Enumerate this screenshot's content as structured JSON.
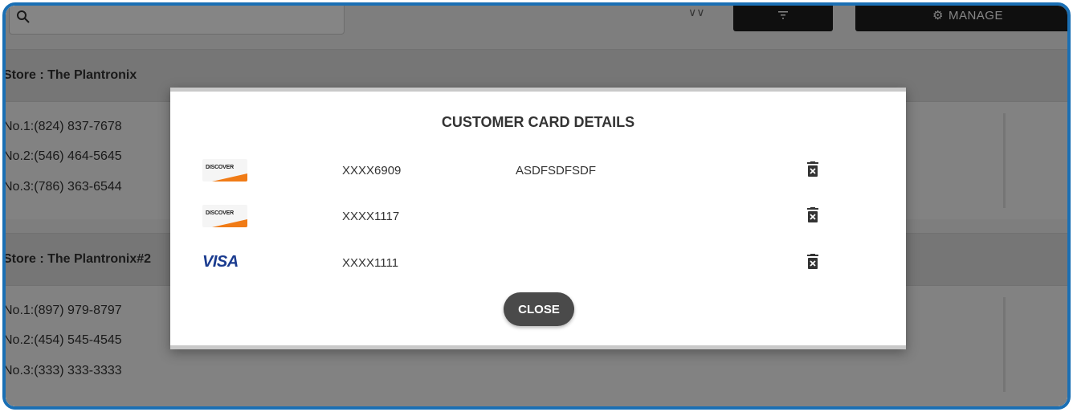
{
  "toolbar": {
    "manage_label": "MANAGE"
  },
  "stores": [
    {
      "header": "Store : The Plantronix",
      "phones": [
        "No.1:(824) 837-7678",
        "No.2:(546) 464-5645",
        "No.3:(786) 363-6544"
      ]
    },
    {
      "header": "Store : The Plantronix#2",
      "phones": [
        "No.1:(897) 979-8797",
        "No.2:(454) 545-4545",
        "No.3:(333) 333-3333"
      ]
    }
  ],
  "modal": {
    "title": "CUSTOMER CARD DETAILS",
    "cards": [
      {
        "brand": "DISCOVER",
        "logo_text": "DISCOVER",
        "number": "XXXX6909",
        "name": "ASDFSDFSDF"
      },
      {
        "brand": "DISCOVER",
        "logo_text": "DISCOVER",
        "number": "XXXX1117",
        "name": ""
      },
      {
        "brand": "VISA",
        "logo_text": "VISA",
        "number": "XXXX1111",
        "name": ""
      }
    ],
    "close_label": "CLOSE"
  },
  "colors": {
    "frame_border": "#1a6fb4",
    "discover_orange": "#f07b16",
    "visa_blue": "#1a3b8f",
    "close_button": "#4a4a4a"
  },
  "icons": [
    "search-icon",
    "chevron-down-icon",
    "filter-icon",
    "gear-icon",
    "trash-icon"
  ]
}
